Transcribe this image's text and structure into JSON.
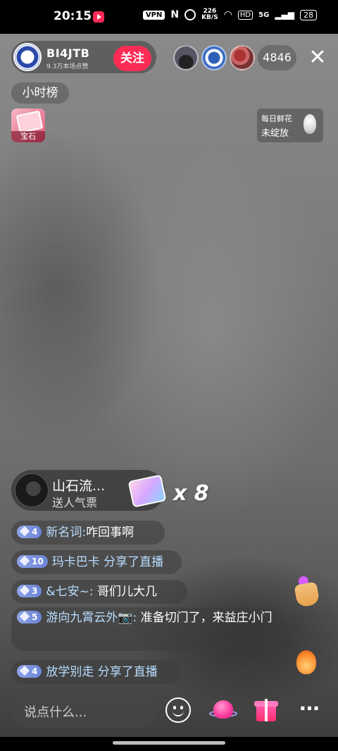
{
  "status_bar": {
    "time": "20:15",
    "vpn": "VPN",
    "nfc": "N",
    "speed_value": "226",
    "speed_unit": "KB/S",
    "hd": "HD",
    "signal": "5G",
    "battery": "28"
  },
  "host": {
    "name": "BI4JTB",
    "likes": "9.3万本场点赞",
    "follow_label": "关注"
  },
  "viewers": {
    "count": "4846",
    "close_label": "✕"
  },
  "hour_rank_label": "小时榜",
  "gem_label": "宝石",
  "flower": {
    "title": "每日鲜花",
    "status": "未绽放"
  },
  "gift": {
    "sender": "山石流...",
    "action": "送人气票",
    "count": "x 8"
  },
  "chat": [
    {
      "level": "4",
      "user": "新名词:",
      "message": "咋回事啊"
    },
    {
      "level": "10",
      "user": "玛卡巴卡",
      "message": "分享了直播"
    },
    {
      "level": "3",
      "user": "&七安~:",
      "message": "哥们儿大几"
    },
    {
      "level": "5",
      "user": "游向九霄云外📷:",
      "message": "准备切门了，来益庄小门"
    },
    {
      "level": "4",
      "user": "放学别走",
      "message": "分享了直播"
    }
  ],
  "input_placeholder": "说点什么...",
  "more_label": "···"
}
